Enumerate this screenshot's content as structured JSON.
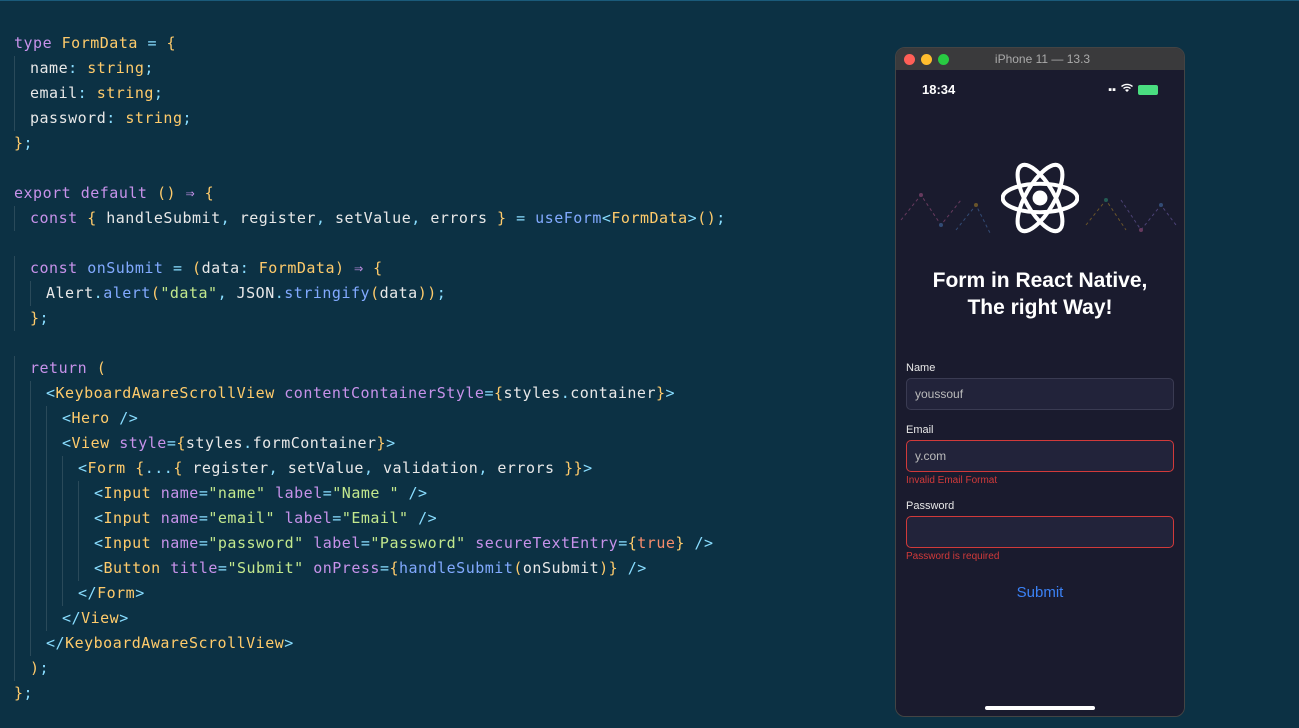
{
  "code": {
    "lines": [
      [
        {
          "c": "kw",
          "t": "type"
        },
        {
          "c": "wh",
          "t": " "
        },
        {
          "c": "ty",
          "t": "FormData"
        },
        {
          "c": "wh",
          "t": " "
        },
        {
          "c": "pn",
          "t": "="
        },
        {
          "c": "wh",
          "t": " "
        },
        {
          "c": "br",
          "t": "{"
        }
      ],
      [
        {
          "indent": 1
        },
        {
          "c": "id",
          "t": "name"
        },
        {
          "c": "pn",
          "t": ":"
        },
        {
          "c": "wh",
          "t": " "
        },
        {
          "c": "ty",
          "t": "string"
        },
        {
          "c": "pn",
          "t": ";"
        }
      ],
      [
        {
          "indent": 1
        },
        {
          "c": "id",
          "t": "email"
        },
        {
          "c": "pn",
          "t": ":"
        },
        {
          "c": "wh",
          "t": " "
        },
        {
          "c": "ty",
          "t": "string"
        },
        {
          "c": "pn",
          "t": ";"
        }
      ],
      [
        {
          "indent": 1
        },
        {
          "c": "id",
          "t": "password"
        },
        {
          "c": "pn",
          "t": ":"
        },
        {
          "c": "wh",
          "t": " "
        },
        {
          "c": "ty",
          "t": "string"
        },
        {
          "c": "pn",
          "t": ";"
        }
      ],
      [
        {
          "c": "br",
          "t": "}"
        },
        {
          "c": "pn",
          "t": ";"
        }
      ],
      [],
      [
        {
          "c": "kw",
          "t": "export"
        },
        {
          "c": "wh",
          "t": " "
        },
        {
          "c": "kw",
          "t": "default"
        },
        {
          "c": "wh",
          "t": " "
        },
        {
          "c": "br",
          "t": "()"
        },
        {
          "c": "wh",
          "t": " "
        },
        {
          "c": "ar",
          "t": "⇒"
        },
        {
          "c": "wh",
          "t": " "
        },
        {
          "c": "br",
          "t": "{"
        }
      ],
      [
        {
          "indent": 1
        },
        {
          "c": "kw",
          "t": "const"
        },
        {
          "c": "wh",
          "t": " "
        },
        {
          "c": "br",
          "t": "{"
        },
        {
          "c": "wh",
          "t": " "
        },
        {
          "c": "id",
          "t": "handleSubmit"
        },
        {
          "c": "pn",
          "t": ","
        },
        {
          "c": "wh",
          "t": " "
        },
        {
          "c": "id",
          "t": "register"
        },
        {
          "c": "pn",
          "t": ","
        },
        {
          "c": "wh",
          "t": " "
        },
        {
          "c": "id",
          "t": "setValue"
        },
        {
          "c": "pn",
          "t": ","
        },
        {
          "c": "wh",
          "t": " "
        },
        {
          "c": "id",
          "t": "errors"
        },
        {
          "c": "wh",
          "t": " "
        },
        {
          "c": "br",
          "t": "}"
        },
        {
          "c": "wh",
          "t": " "
        },
        {
          "c": "pn",
          "t": "="
        },
        {
          "c": "wh",
          "t": " "
        },
        {
          "c": "fn",
          "t": "useForm"
        },
        {
          "c": "pn",
          "t": "<"
        },
        {
          "c": "ty",
          "t": "FormData"
        },
        {
          "c": "pn",
          "t": ">"
        },
        {
          "c": "br",
          "t": "()"
        },
        {
          "c": "pn",
          "t": ";"
        }
      ],
      [],
      [
        {
          "indent": 1
        },
        {
          "c": "kw",
          "t": "const"
        },
        {
          "c": "wh",
          "t": " "
        },
        {
          "c": "fn",
          "t": "onSubmit"
        },
        {
          "c": "wh",
          "t": " "
        },
        {
          "c": "pn",
          "t": "="
        },
        {
          "c": "wh",
          "t": " "
        },
        {
          "c": "br",
          "t": "("
        },
        {
          "c": "id",
          "t": "data"
        },
        {
          "c": "pn",
          "t": ":"
        },
        {
          "c": "wh",
          "t": " "
        },
        {
          "c": "ty",
          "t": "FormData"
        },
        {
          "c": "br",
          "t": ")"
        },
        {
          "c": "wh",
          "t": " "
        },
        {
          "c": "ar",
          "t": "⇒"
        },
        {
          "c": "wh",
          "t": " "
        },
        {
          "c": "br",
          "t": "{"
        }
      ],
      [
        {
          "indent": 2
        },
        {
          "c": "id",
          "t": "Alert"
        },
        {
          "c": "pn",
          "t": "."
        },
        {
          "c": "fn",
          "t": "alert"
        },
        {
          "c": "br",
          "t": "("
        },
        {
          "c": "st",
          "t": "\"data\""
        },
        {
          "c": "pn",
          "t": ","
        },
        {
          "c": "wh",
          "t": " "
        },
        {
          "c": "id",
          "t": "JSON"
        },
        {
          "c": "pn",
          "t": "."
        },
        {
          "c": "fn",
          "t": "stringify"
        },
        {
          "c": "br",
          "t": "("
        },
        {
          "c": "id",
          "t": "data"
        },
        {
          "c": "br",
          "t": "))"
        },
        {
          "c": "pn",
          "t": ";"
        }
      ],
      [
        {
          "indent": 1
        },
        {
          "c": "br",
          "t": "}"
        },
        {
          "c": "pn",
          "t": ";"
        }
      ],
      [],
      [
        {
          "indent": 1
        },
        {
          "c": "kw",
          "t": "return"
        },
        {
          "c": "wh",
          "t": " "
        },
        {
          "c": "br",
          "t": "("
        }
      ],
      [
        {
          "indent": 2
        },
        {
          "c": "pn",
          "t": "<"
        },
        {
          "c": "ty",
          "t": "KeyboardAwareScrollView"
        },
        {
          "c": "wh",
          "t": " "
        },
        {
          "c": "at",
          "t": "contentContainerStyle"
        },
        {
          "c": "pn",
          "t": "="
        },
        {
          "c": "br",
          "t": "{"
        },
        {
          "c": "id",
          "t": "styles"
        },
        {
          "c": "pn",
          "t": "."
        },
        {
          "c": "id",
          "t": "container"
        },
        {
          "c": "br",
          "t": "}"
        },
        {
          "c": "pn",
          "t": ">"
        }
      ],
      [
        {
          "indent": 3
        },
        {
          "c": "pn",
          "t": "<"
        },
        {
          "c": "ty",
          "t": "Hero"
        },
        {
          "c": "wh",
          "t": " "
        },
        {
          "c": "pn",
          "t": "/>"
        }
      ],
      [
        {
          "indent": 3
        },
        {
          "c": "pn",
          "t": "<"
        },
        {
          "c": "ty",
          "t": "View"
        },
        {
          "c": "wh",
          "t": " "
        },
        {
          "c": "at",
          "t": "style"
        },
        {
          "c": "pn",
          "t": "="
        },
        {
          "c": "br",
          "t": "{"
        },
        {
          "c": "id",
          "t": "styles"
        },
        {
          "c": "pn",
          "t": "."
        },
        {
          "c": "id",
          "t": "formContainer"
        },
        {
          "c": "br",
          "t": "}"
        },
        {
          "c": "pn",
          "t": ">"
        }
      ],
      [
        {
          "indent": 4
        },
        {
          "c": "pn",
          "t": "<"
        },
        {
          "c": "ty",
          "t": "Form"
        },
        {
          "c": "wh",
          "t": " "
        },
        {
          "c": "br",
          "t": "{"
        },
        {
          "c": "pn",
          "t": "..."
        },
        {
          "c": "br",
          "t": "{"
        },
        {
          "c": "wh",
          "t": " "
        },
        {
          "c": "id",
          "t": "register"
        },
        {
          "c": "pn",
          "t": ","
        },
        {
          "c": "wh",
          "t": " "
        },
        {
          "c": "id",
          "t": "setValue"
        },
        {
          "c": "pn",
          "t": ","
        },
        {
          "c": "wh",
          "t": " "
        },
        {
          "c": "id",
          "t": "validation"
        },
        {
          "c": "pn",
          "t": ","
        },
        {
          "c": "wh",
          "t": " "
        },
        {
          "c": "id",
          "t": "errors"
        },
        {
          "c": "wh",
          "t": " "
        },
        {
          "c": "br",
          "t": "}}"
        },
        {
          "c": "pn",
          "t": ">"
        }
      ],
      [
        {
          "indent": 5
        },
        {
          "c": "pn",
          "t": "<"
        },
        {
          "c": "ty",
          "t": "Input"
        },
        {
          "c": "wh",
          "t": " "
        },
        {
          "c": "at",
          "t": "name"
        },
        {
          "c": "pn",
          "t": "="
        },
        {
          "c": "st",
          "t": "\"name\""
        },
        {
          "c": "wh",
          "t": " "
        },
        {
          "c": "at",
          "t": "label"
        },
        {
          "c": "pn",
          "t": "="
        },
        {
          "c": "st",
          "t": "\"Name \""
        },
        {
          "c": "wh",
          "t": " "
        },
        {
          "c": "pn",
          "t": "/>"
        }
      ],
      [
        {
          "indent": 5
        },
        {
          "c": "pn",
          "t": "<"
        },
        {
          "c": "ty",
          "t": "Input"
        },
        {
          "c": "wh",
          "t": " "
        },
        {
          "c": "at",
          "t": "name"
        },
        {
          "c": "pn",
          "t": "="
        },
        {
          "c": "st",
          "t": "\"email\""
        },
        {
          "c": "wh",
          "t": " "
        },
        {
          "c": "at",
          "t": "label"
        },
        {
          "c": "pn",
          "t": "="
        },
        {
          "c": "st",
          "t": "\"Email\""
        },
        {
          "c": "wh",
          "t": " "
        },
        {
          "c": "pn",
          "t": "/>"
        }
      ],
      [
        {
          "indent": 5
        },
        {
          "c": "pn",
          "t": "<"
        },
        {
          "c": "ty",
          "t": "Input"
        },
        {
          "c": "wh",
          "t": " "
        },
        {
          "c": "at",
          "t": "name"
        },
        {
          "c": "pn",
          "t": "="
        },
        {
          "c": "st",
          "t": "\"password\""
        },
        {
          "c": "wh",
          "t": " "
        },
        {
          "c": "at",
          "t": "label"
        },
        {
          "c": "pn",
          "t": "="
        },
        {
          "c": "st",
          "t": "\"Password\""
        },
        {
          "c": "wh",
          "t": " "
        },
        {
          "c": "at",
          "t": "secureTextEntry"
        },
        {
          "c": "pn",
          "t": "="
        },
        {
          "c": "br",
          "t": "{"
        },
        {
          "c": "nm",
          "t": "true"
        },
        {
          "c": "br",
          "t": "}"
        },
        {
          "c": "wh",
          "t": " "
        },
        {
          "c": "pn",
          "t": "/>"
        }
      ],
      [
        {
          "indent": 5
        },
        {
          "c": "pn",
          "t": "<"
        },
        {
          "c": "ty",
          "t": "Button"
        },
        {
          "c": "wh",
          "t": " "
        },
        {
          "c": "at",
          "t": "title"
        },
        {
          "c": "pn",
          "t": "="
        },
        {
          "c": "st",
          "t": "\"Submit\""
        },
        {
          "c": "wh",
          "t": " "
        },
        {
          "c": "at",
          "t": "onPress"
        },
        {
          "c": "pn",
          "t": "="
        },
        {
          "c": "br",
          "t": "{"
        },
        {
          "c": "fn",
          "t": "handleSubmit"
        },
        {
          "c": "br",
          "t": "("
        },
        {
          "c": "id",
          "t": "onSubmit"
        },
        {
          "c": "br",
          "t": ")}"
        },
        {
          "c": "wh",
          "t": " "
        },
        {
          "c": "pn",
          "t": "/>"
        }
      ],
      [
        {
          "indent": 4
        },
        {
          "c": "pn",
          "t": "</"
        },
        {
          "c": "ty",
          "t": "Form"
        },
        {
          "c": "pn",
          "t": ">"
        }
      ],
      [
        {
          "indent": 3
        },
        {
          "c": "pn",
          "t": "</"
        },
        {
          "c": "ty",
          "t": "View"
        },
        {
          "c": "pn",
          "t": ">"
        }
      ],
      [
        {
          "indent": 2
        },
        {
          "c": "pn",
          "t": "</"
        },
        {
          "c": "ty",
          "t": "KeyboardAwareScrollView"
        },
        {
          "c": "pn",
          "t": ">"
        }
      ],
      [
        {
          "indent": 1
        },
        {
          "c": "br",
          "t": ")"
        },
        {
          "c": "pn",
          "t": ";"
        }
      ],
      [
        {
          "c": "br",
          "t": "}"
        },
        {
          "c": "pn",
          "t": ";"
        }
      ]
    ]
  },
  "phone": {
    "window_title": "iPhone 11 — 13.3",
    "status_time": "18:34",
    "hero_title_line1": "Form in React Native,",
    "hero_title_line2": "The right Way!",
    "fields": {
      "name": {
        "label": "Name",
        "value": "youssouf",
        "error": ""
      },
      "email": {
        "label": "Email",
        "value": "y.com",
        "error": "Invalid Email Format"
      },
      "password": {
        "label": "Password",
        "value": "",
        "error": "Password is required"
      }
    },
    "submit_label": "Submit"
  }
}
